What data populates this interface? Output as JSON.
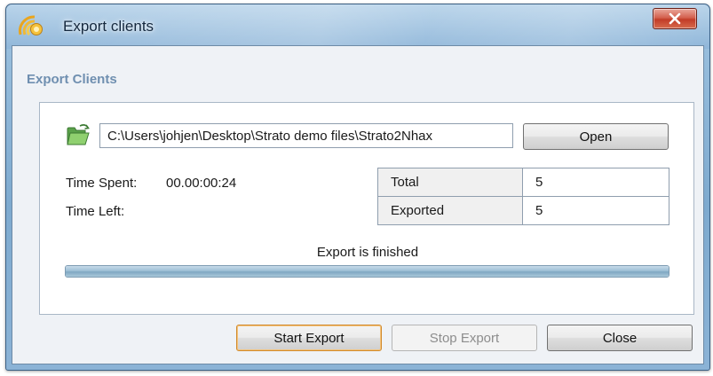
{
  "window": {
    "title": "Export clients",
    "close_glyph": "X"
  },
  "group": {
    "title": "Export Clients"
  },
  "path": {
    "value": "C:\\Users\\johjen\\Desktop\\Strato demo files\\Strato2Nhax",
    "open_label": "Open"
  },
  "time": {
    "spent_label": "Time Spent:",
    "spent_value": "00.00:00:24",
    "left_label": "Time Left:",
    "left_value": ""
  },
  "stats": [
    {
      "label": "Total",
      "value": "5"
    },
    {
      "label": "Exported",
      "value": "5"
    }
  ],
  "progress": {
    "status": "Export is finished",
    "fraction": 1.0
  },
  "buttons": {
    "start": "Start Export",
    "stop": "Stop Export",
    "close": "Close"
  },
  "icons": {
    "app": "strato-app-icon",
    "folder": "open-folder-icon",
    "close": "close-icon"
  },
  "colors": {
    "accent": "#6f8fb0",
    "default_button_border": "#d08a2e",
    "close_button": "#c23c28"
  }
}
